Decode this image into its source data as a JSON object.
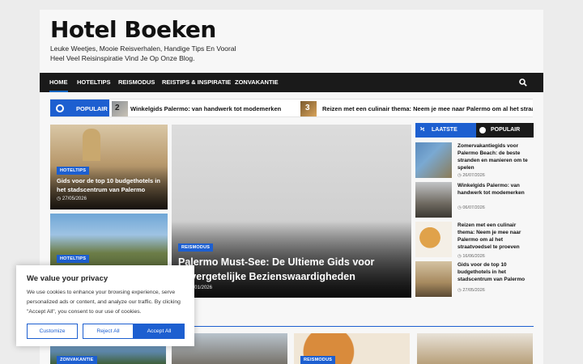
{
  "site": {
    "title": "Hotel Boeken",
    "tagline": "Leuke Weetjes, Mooie Reisverhalen, Handige Tips En Vooral Heel Veel Reisinspiratie Vind Je Op Onze Blog."
  },
  "nav": {
    "items": [
      "Home",
      "HOTELTIPS",
      "REISMODUS",
      "REISTIPS & INSPIRATIE",
      "ZONVAKANTIE"
    ],
    "search_icon": "search-icon"
  },
  "ticker": {
    "label": "POPULAIR",
    "items": [
      {
        "num": "2",
        "title": "Winkelgids Palermo: van handwerk tot modemerken"
      },
      {
        "num": "3",
        "title": "Reizen met een culinair thema: Neem je mee naar Palermo om al het straa"
      }
    ]
  },
  "featured": {
    "left_top": {
      "tag": "HOTELTIPS",
      "title": " Gids voor de top 10 budgethotels in het stadscentrum van Palermo",
      "date": "27/05/2026"
    },
    "left_bottom": {
      "tag": "HOTELTIPS"
    },
    "main": {
      "tag": "REISMODUS",
      "title": "Palermo Must-See: De Ultieme Gids voor onvergetelijke Bezienswaardigheden",
      "author": "n",
      "date": "27/01/2026"
    }
  },
  "sidebar": {
    "tabs": [
      "LAATSTE",
      "POPULAIR"
    ],
    "items": [
      {
        "title": "Zomervakantiegids voor Palermo Beach: de beste stranden en manieren om te spelen",
        "date": "26/07/2026"
      },
      {
        "title": "Winkelgids Palermo: van handwerk tot modemerken",
        "date": "06/07/2026"
      },
      {
        "title": "Reizen met een culinair thema: Neem je mee naar Palermo om al het straatvoedsel te proeven",
        "date": "16/06/2026"
      },
      {
        "title": " Gids voor de top 10 budgethotels in het stadscentrum van Palermo",
        "date": "27/05/2026"
      }
    ]
  },
  "bottom_row": {
    "tags": [
      "ZONVAKANTIE",
      "REISMODUS"
    ]
  },
  "cookie": {
    "title": "We value your privacy",
    "text": "We use cookies to enhance your browsing experience, serve personalized ads or content, and analyze our traffic. By clicking \"Accept All\", you consent to our use of cookies.",
    "customize": "Customize",
    "reject": "Reject All",
    "accept": "Accept All"
  },
  "colors": {
    "accent": "#1d5fd0",
    "nav_bg": "#1a1a1a"
  }
}
